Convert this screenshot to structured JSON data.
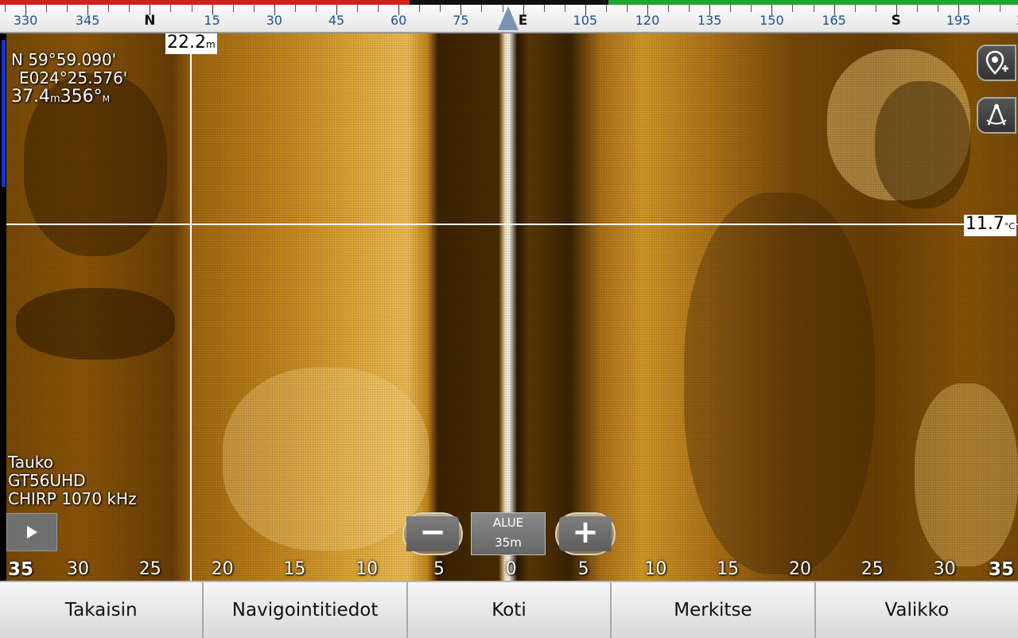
{
  "compass": {
    "labels": [
      {
        "text": "330",
        "cardinal": false
      },
      {
        "text": "345",
        "cardinal": false
      },
      {
        "text": "N",
        "cardinal": true
      },
      {
        "text": "15",
        "cardinal": false
      },
      {
        "text": "30",
        "cardinal": false
      },
      {
        "text": "45",
        "cardinal": false
      },
      {
        "text": "60",
        "cardinal": false
      },
      {
        "text": "75",
        "cardinal": false
      },
      {
        "text": "E",
        "cardinal": true
      },
      {
        "text": "105",
        "cardinal": false
      },
      {
        "text": "120",
        "cardinal": false
      },
      {
        "text": "135",
        "cardinal": false
      },
      {
        "text": "150",
        "cardinal": false
      },
      {
        "text": "165",
        "cardinal": false
      },
      {
        "text": "S",
        "cardinal": true
      },
      {
        "text": "195",
        "cardinal": false
      },
      {
        "text": "2",
        "cardinal": false
      }
    ],
    "port_color": "#d41f1f",
    "starboard_color": "#22a52a"
  },
  "cursor": {
    "range_label": "22.2",
    "range_unit": "m",
    "depth_label": "11.7",
    "depth_unit": "°C"
  },
  "gps": {
    "lat": "N  59°59.090'",
    "lon": "E024°25.576'",
    "distance": "37.4",
    "distance_unit": "m",
    "bearing": "356°",
    "bearing_unit": "M"
  },
  "status": {
    "state": "Tauko",
    "transducer": "GT56UHD",
    "frequency": "CHIRP 1070 kHz"
  },
  "side_buttons": {
    "waypoint_icon": "add-waypoint-icon",
    "measure_icon": "measure-icon"
  },
  "range_control": {
    "minus": "−",
    "plus": "+",
    "title": "ALUE",
    "value": "35m"
  },
  "scale": {
    "labels": [
      "35",
      "30",
      "25",
      "20",
      "15",
      "10",
      "5",
      "0",
      "5",
      "10",
      "15",
      "20",
      "25",
      "30",
      "35"
    ]
  },
  "bottom_bar": {
    "buttons": [
      "Takaisin",
      "Navigointitiedot",
      "Koti",
      "Merkitse",
      "Valikko"
    ]
  },
  "colors": {
    "sonar_dark": "#3a2303",
    "sonar_bright": "#f3c25a",
    "accent_blue": "#1533d8"
  }
}
